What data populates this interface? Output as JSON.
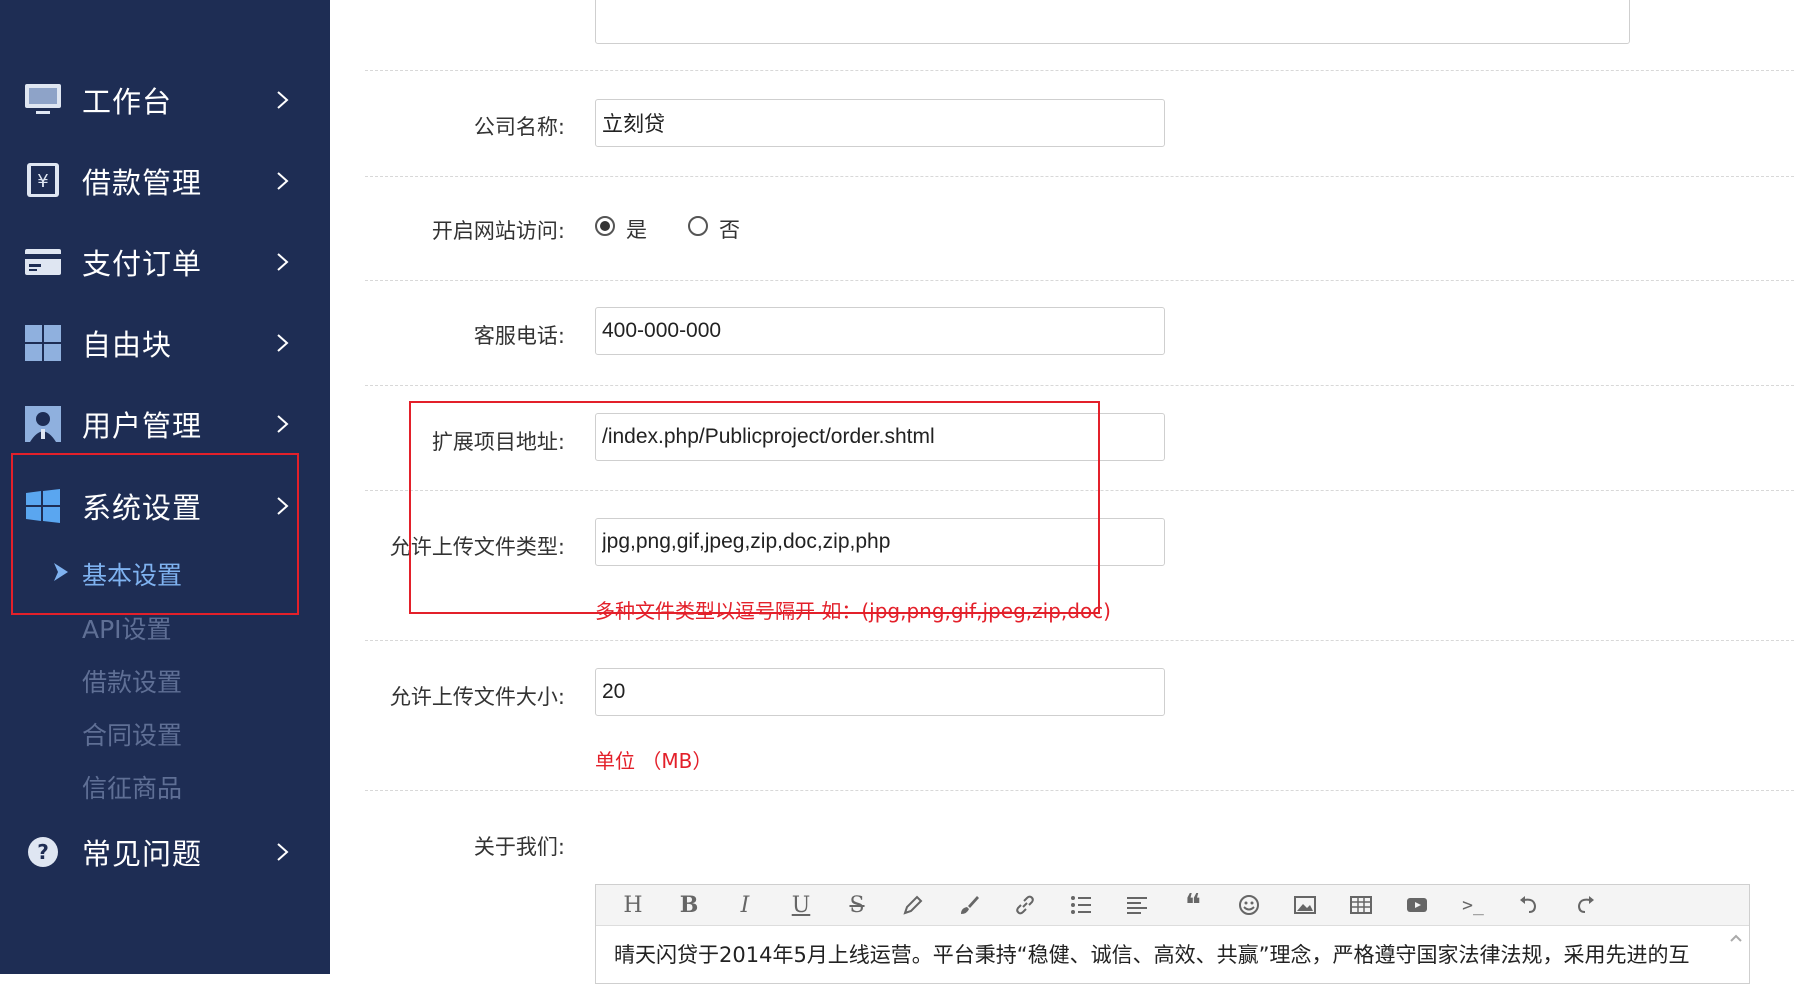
{
  "sidebar": {
    "items": [
      {
        "label": "工作台",
        "icon": "monitor-icon"
      },
      {
        "label": "借款管理",
        "icon": "yuan-book-icon"
      },
      {
        "label": "支付订单",
        "icon": "card-icon"
      },
      {
        "label": "自由块",
        "icon": "grid-blocks-icon"
      },
      {
        "label": "用户管理",
        "icon": "user-icon"
      },
      {
        "label": "系统设置",
        "icon": "windows-icon"
      },
      {
        "label": "常见问题",
        "icon": "question-icon"
      }
    ],
    "sub_items": [
      {
        "label": "基本设置",
        "active": true
      },
      {
        "label": "API设置"
      },
      {
        "label": "借款设置"
      },
      {
        "label": "合同设置"
      },
      {
        "label": "信征商品"
      }
    ]
  },
  "form": {
    "company_name": {
      "label": "公司名称:",
      "value": "立刻贷"
    },
    "site_access": {
      "label": "开启网站访问:",
      "option_yes": "是",
      "option_no": "否",
      "selected": "是"
    },
    "service_phone": {
      "label": "客服电话:",
      "value": "400-000-000"
    },
    "ext_project_url": {
      "label": "扩展项目地址:",
      "value": "/index.php/Publicproject/order.shtml"
    },
    "upload_types": {
      "label": "允许上传文件类型:",
      "value": "jpg,png,gif,jpeg,zip,doc,zip,php",
      "hint": "多种文件类型以逗号隔开 如：(jpg,png,gif,jpeg,zip,doc)"
    },
    "upload_size": {
      "label": "允许上传文件大小:",
      "value": "20",
      "hint": "单位 （MB）"
    },
    "about_us": {
      "label": "关于我们:",
      "content": "晴天闪贷于2014年5月上线运营。平台秉持“稳健、诚信、高效、共赢”理念，严格遵守国家法律法规，采用先进的互"
    }
  },
  "editor_toolbar": [
    "heading-icon",
    "bold-icon",
    "italic-icon",
    "underline-icon",
    "strikethrough-icon",
    "pen-icon",
    "brush-icon",
    "link-icon",
    "list-icon",
    "align-icon",
    "quote-icon",
    "emoji-icon",
    "image-icon",
    "table-icon",
    "video-icon",
    "code-icon",
    "undo-icon",
    "redo-icon"
  ],
  "colors": {
    "sidebar_bg": "#1e2d54",
    "active_sub": "#7fb2f0",
    "hint_red": "#e3202a",
    "highlight_box": "#e3202a"
  }
}
